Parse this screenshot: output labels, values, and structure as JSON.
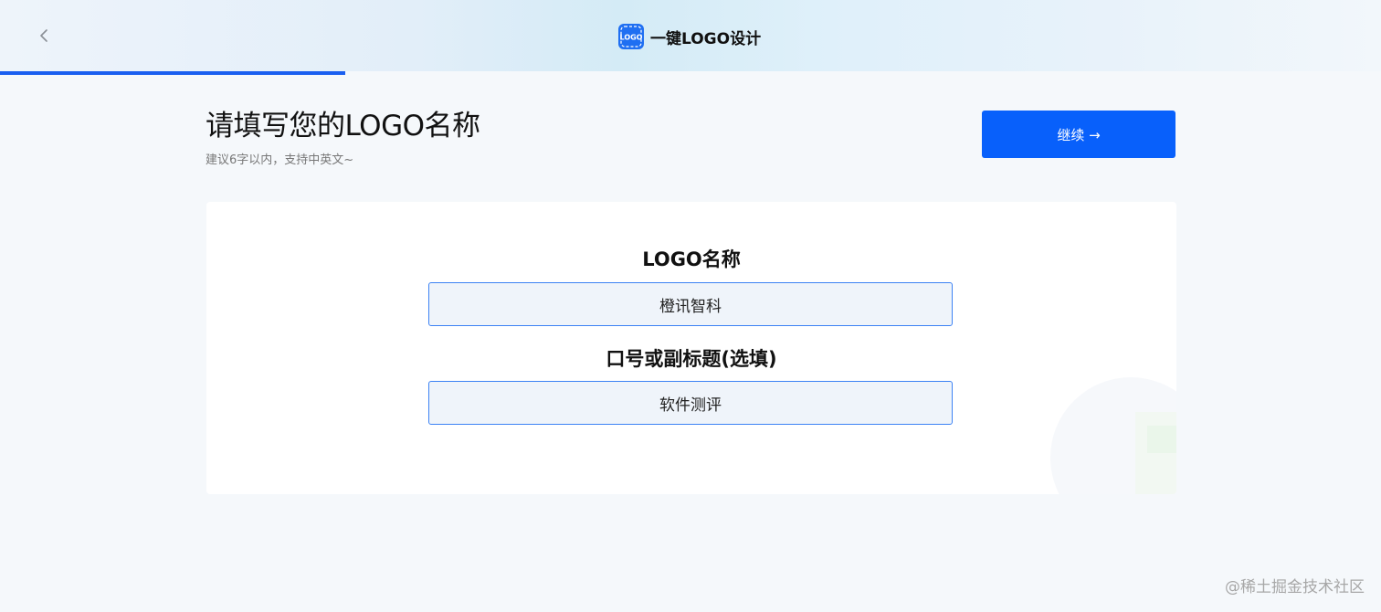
{
  "header": {
    "back_icon": "chevron-left-icon",
    "brand_logo_icon": "logo-badge-icon",
    "brand_logo_text": "LOGO",
    "brand_title": "一键LOGO设计",
    "progress_percent": 25
  },
  "heading": {
    "title": "请填写您的LOGO名称",
    "subtitle": "建议6字以内，支持中英文~"
  },
  "actions": {
    "continue_label": "继续 →"
  },
  "form": {
    "name_label": "LOGO名称",
    "name_value": "橙讯智科",
    "slogan_label": "口号或副标题(选填)",
    "slogan_value": "软件测评"
  },
  "watermark": "@稀土掘金技术社区",
  "colors": {
    "accent": "#0860fb",
    "input_border": "#3c82f4",
    "input_bg": "#eff4fa",
    "page_bg": "#f5f8fb"
  }
}
